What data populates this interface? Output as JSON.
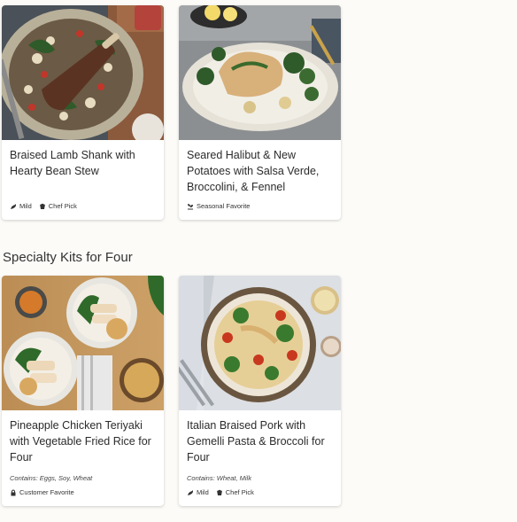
{
  "section": {
    "title": "Specialty Kits for Four"
  },
  "cards": [
    {
      "title": "Braised Lamb Shank with Hearty Bean Stew",
      "contains": "",
      "tags": [
        {
          "icon": "pepper-icon",
          "label": "Mild"
        },
        {
          "icon": "chef-hat-icon",
          "label": "Chef Pick"
        }
      ]
    },
    {
      "title": "Seared Halibut & New Potatoes with Salsa Verde, Broccolini, & Fennel",
      "contains": "",
      "tags": [
        {
          "icon": "sprout-icon",
          "label": "Seasonal Favorite"
        }
      ]
    },
    {
      "title": "Pineapple Chicken Teriyaki with Vegetable Fried Rice for Four",
      "contains": "Contains: Eggs, Soy, Wheat",
      "tags": [
        {
          "icon": "lock-icon",
          "label": "Customer Favorite"
        }
      ]
    },
    {
      "title": "Italian Braised Pork with Gemelli Pasta & Broccoli for Four",
      "contains": "Contains: Wheat, Milk",
      "tags": [
        {
          "icon": "pepper-icon",
          "label": "Mild"
        },
        {
          "icon": "chef-hat-icon",
          "label": "Chef Pick"
        }
      ]
    }
  ]
}
